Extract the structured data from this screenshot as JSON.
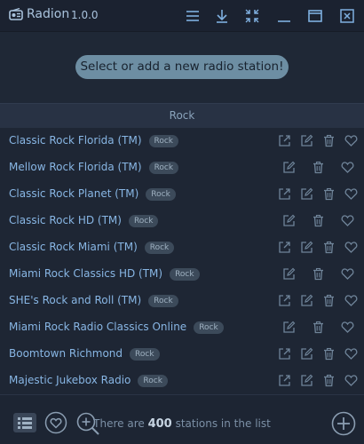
{
  "app": {
    "name": "Radion",
    "version": "1.0.0"
  },
  "titlebar": {
    "buttons": [
      {
        "name": "menu-button",
        "icon": "menu-icon"
      },
      {
        "name": "download-button",
        "icon": "download-icon"
      },
      {
        "name": "compress-button",
        "icon": "compress-icon"
      },
      {
        "name": "minimize-button",
        "icon": "minimize-icon"
      },
      {
        "name": "maximize-button",
        "icon": "maximize-icon"
      },
      {
        "name": "close-button",
        "icon": "close-icon"
      }
    ]
  },
  "player": {
    "placeholder": "Select or add a new radio station!"
  },
  "group": {
    "label": "Rock"
  },
  "stations": [
    {
      "name": "Classic Rock Florida (TM)",
      "tag": "Rock",
      "share": true
    },
    {
      "name": "Mellow Rock Florida (TM)",
      "tag": "Rock",
      "share": false
    },
    {
      "name": "Classic Rock Planet (TM)",
      "tag": "Rock",
      "share": true
    },
    {
      "name": "Classic Rock HD (TM)",
      "tag": "Rock",
      "share": false
    },
    {
      "name": "Classic Rock Miami (TM)",
      "tag": "Rock",
      "share": true
    },
    {
      "name": "Miami Rock Classics HD (TM)",
      "tag": "Rock",
      "share": false
    },
    {
      "name": "SHE's Rock and Roll (TM)",
      "tag": "Rock",
      "share": true
    },
    {
      "name": "Miami Rock Radio Classics Online",
      "tag": "Rock",
      "share": false
    },
    {
      "name": "Boomtown Richmond",
      "tag": "Rock",
      "share": true
    },
    {
      "name": "Majestic Jukebox Radio",
      "tag": "Rock",
      "share": true
    }
  ],
  "status": {
    "prefix": "There are",
    "count": "400",
    "suffix": "stations in the list"
  },
  "colors": {
    "accent": "#88b6e4",
    "pill": "#6d8ea3",
    "background": "#1d2533"
  }
}
